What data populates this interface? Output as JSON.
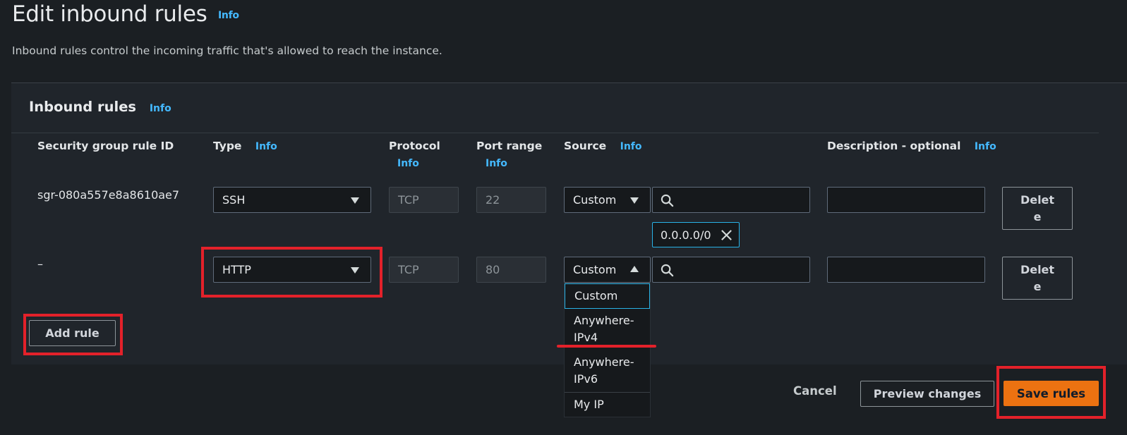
{
  "header": {
    "title": "Edit inbound rules",
    "info": "Info",
    "subtitle": "Inbound rules control the incoming traffic that's allowed to reach the instance."
  },
  "panel": {
    "title": "Inbound rules",
    "info": "Info"
  },
  "columns": {
    "rule_id": "Security group rule ID",
    "type": "Type",
    "type_info": "Info",
    "protocol": "Protocol",
    "protocol_info": "Info",
    "port_range": "Port range",
    "port_range_info": "Info",
    "source": "Source",
    "source_info": "Info",
    "description": "Description - optional",
    "description_info": "Info"
  },
  "rules": [
    {
      "rule_id": "sgr-080a557e8a8610ae7",
      "type": "SSH",
      "protocol": "TCP",
      "port_range": "22",
      "source": "Custom",
      "source_search": "",
      "source_token": "0.0.0.0/0",
      "description": "",
      "delete_label": "Delete"
    },
    {
      "rule_id": "–",
      "type": "HTTP",
      "protocol": "TCP",
      "port_range": "80",
      "source": "Custom",
      "source_search": "",
      "description": "",
      "delete_label": "Delete"
    }
  ],
  "source_dropdown": {
    "options": [
      "Custom",
      "Anywhere-IPv4",
      "Anywhere-IPv6",
      "My IP"
    ],
    "selected": "Custom"
  },
  "add_rule_label": "Add rule",
  "footer": {
    "cancel": "Cancel",
    "preview": "Preview changes",
    "save": "Save rules"
  },
  "colors": {
    "accent": "#ec7211",
    "info_link": "#44b9ff",
    "focus": "#29b2e6",
    "highlight": "#e3212a"
  },
  "icons": {
    "search": "search-icon",
    "dismiss": "close-icon",
    "dropdown": "caret-down-icon"
  }
}
